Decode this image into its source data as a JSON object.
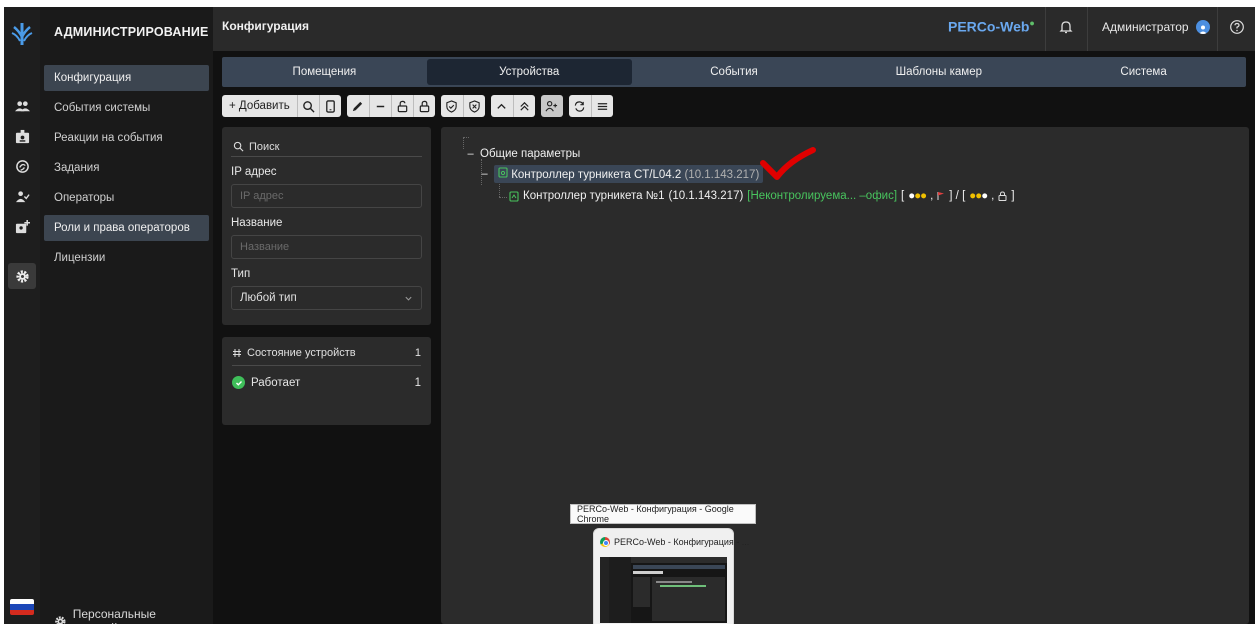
{
  "sidebar": {
    "header": "АДМИНИСТРИРОВАНИЕ",
    "items": [
      {
        "label": "Конфигурация",
        "active": true
      },
      {
        "label": "События системы",
        "active": false
      },
      {
        "label": "Реакции на события",
        "active": false
      },
      {
        "label": "Задания",
        "active": false
      },
      {
        "label": "Операторы",
        "active": false
      },
      {
        "label": "Роли и права операторов",
        "active": false
      },
      {
        "label": "Лицензии",
        "active": false
      }
    ],
    "personal_settings": "Персональные настройки"
  },
  "rail": {
    "icons": [
      "users-icon",
      "id-card-icon",
      "face-icon",
      "user-check-icon",
      "badge-add-icon",
      "gear-icon"
    ],
    "active_icon": "gear-icon",
    "language_flag": "russian-flag-icon"
  },
  "topbar": {
    "title": "Конфигурация",
    "brand": "PERCo-Web",
    "user": "Администратор"
  },
  "tabs": [
    {
      "label": "Помещения",
      "active": false
    },
    {
      "label": "Устройства",
      "active": true
    },
    {
      "label": "События",
      "active": false
    },
    {
      "label": "Шаблоны камер",
      "active": false
    },
    {
      "label": "Система",
      "active": false
    }
  ],
  "toolbar": {
    "add_label": "+ Добавить"
  },
  "filter": {
    "search_label": "Поиск",
    "ip_label": "IP адрес",
    "ip_placeholder": "IP адрес",
    "name_label": "Название",
    "name_placeholder": "Название",
    "type_label": "Тип",
    "type_value": "Любой тип"
  },
  "status": {
    "header": "Состояние устройств",
    "header_count": "1",
    "rows": [
      {
        "label": "Работает",
        "count": "1"
      }
    ]
  },
  "tree": {
    "root": "Общие параметры",
    "controller": {
      "name": "Контроллер турникета CT/L04.2",
      "ip": "(10.1.143.217)"
    },
    "child": {
      "name": "Контроллер турникета №1",
      "ip": "(10.1.143.217)",
      "zone": "[Неконтролируема... –офис]",
      "status_a_open": " [",
      "status_a_close": "] / [",
      "status_b_close": "]"
    }
  },
  "taskbar": {
    "tooltip": "PERCo-Web - Конфигурация - Google Chrome",
    "preview_title": "PERCo-Web - Конфигурация - ..."
  }
}
